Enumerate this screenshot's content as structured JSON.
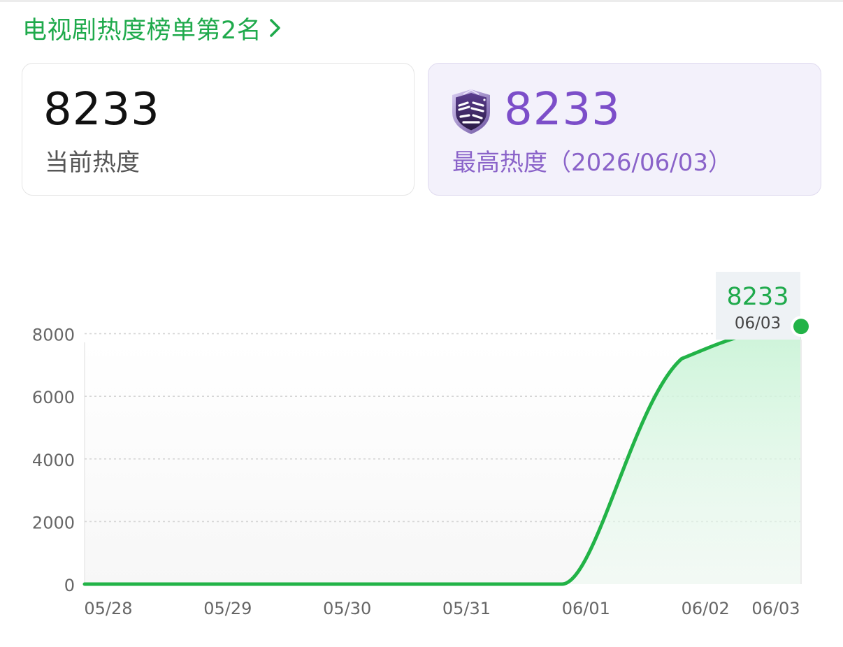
{
  "header": {
    "rank_title": "电视剧热度榜单第2名"
  },
  "current_card": {
    "value": "8233",
    "label": "当前热度"
  },
  "peak_card": {
    "badge_icon": "jiapian-diantang-badge-icon",
    "value": "8233",
    "label": "最高热度（2026/06/03）"
  },
  "colors": {
    "accent_green": "#1faa4c",
    "line_green": "#22b347",
    "peak_purple": "#7c4ec9"
  },
  "chart_data": {
    "type": "area",
    "categories": [
      "05/28",
      "05/29",
      "05/30",
      "05/31",
      "06/01",
      "06/02",
      "06/03"
    ],
    "series": [
      {
        "values": [
          0,
          0,
          0,
          0,
          0,
          7200,
          8233
        ]
      }
    ],
    "yticks": [
      "0",
      "2000",
      "4000",
      "6000",
      "8000"
    ],
    "ylim": [
      0,
      10000
    ],
    "grid": true,
    "tooltip": {
      "value": "8233",
      "date": "06/03"
    }
  }
}
